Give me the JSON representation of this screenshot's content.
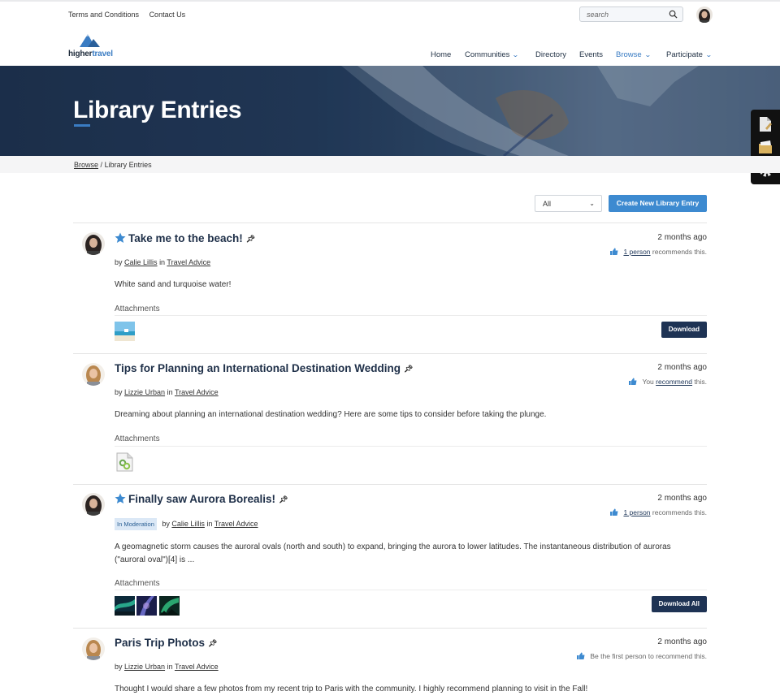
{
  "utility": {
    "terms": "Terms and Conditions",
    "contact": "Contact Us"
  },
  "search": {
    "placeholder": "search"
  },
  "brand": {
    "logo_text_a": "higher",
    "logo_text_b": "travel"
  },
  "nav": [
    {
      "label": "Home",
      "dropdown": false
    },
    {
      "label": "Communities",
      "dropdown": true
    },
    {
      "label": "Directory",
      "dropdown": false
    },
    {
      "label": "Events",
      "dropdown": false
    },
    {
      "label": "Browse",
      "dropdown": true,
      "active": true
    },
    {
      "label": "Participate",
      "dropdown": true
    }
  ],
  "hero": {
    "title": "Library Entries"
  },
  "breadcrumb": {
    "parent": "Browse",
    "separator": "/",
    "current": "Library Entries"
  },
  "controls": {
    "filter_value": "All",
    "create_label": "Create New Library Entry"
  },
  "labels": {
    "by": "by",
    "in": "in",
    "attachments": "Attachments"
  },
  "colors": {
    "accent": "#3d8ad0",
    "navy": "#1e3354",
    "hero": "#1c2e4a"
  },
  "entries": [
    {
      "title": "Take me to the beach!",
      "starred": true,
      "pinned": true,
      "author": "Calie Lillis",
      "community": "Travel Advice",
      "moderation": "",
      "time": "2 months ago",
      "rec_link": "1 person",
      "rec_text": " recommends this.",
      "body": "White sand and turquoise water!",
      "action": "Download"
    },
    {
      "title": "Tips for Planning an International Destination Wedding",
      "starred": false,
      "pinned": true,
      "author": "Lizzie Urban",
      "community": "Travel Advice",
      "moderation": "",
      "time": "2 months ago",
      "rec_pre": "You ",
      "rec_link": "recommend",
      "rec_text": " this.",
      "body": "Dreaming about planning an international destination wedding? Here are some tips to consider before taking the plunge.",
      "action": ""
    },
    {
      "title": "Finally saw Aurora Borealis!",
      "starred": true,
      "pinned": true,
      "author": "Calie Lillis",
      "community": "Travel Advice",
      "moderation": "In Moderation",
      "time": "2 months ago",
      "rec_link": "1 person",
      "rec_text": " recommends this.",
      "body": "A geomagnetic storm  causes the auroral ovals (north and south) to expand, bringing the aurora to lower latitudes. The instantaneous distribution of auroras (\"auroral oval\")[4]  is ...",
      "action": "Download All"
    },
    {
      "title": "Paris Trip Photos",
      "starred": false,
      "pinned": true,
      "author": "Lizzie Urban",
      "community": "Travel Advice",
      "moderation": "",
      "time": "2 months ago",
      "rec_text": "Be the first person to recommend this.",
      "body": "Thought I would share a few photos from my recent trip to Paris with the community. I highly recommend planning to visit in the Fall!",
      "action": ""
    }
  ]
}
